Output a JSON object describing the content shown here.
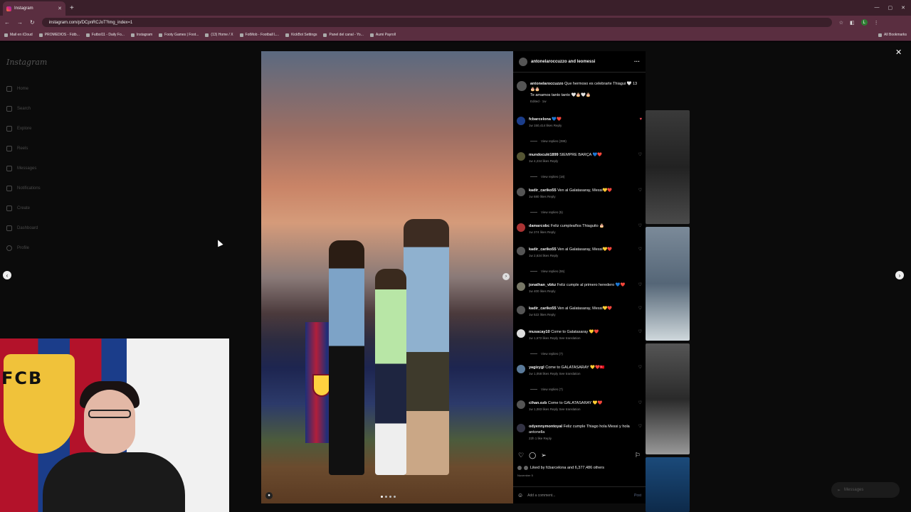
{
  "browser": {
    "tab_title": "Instagram",
    "tab_close": "✕",
    "new_tab": "+",
    "url": "instagram.com/p/DCpnRCJoT?img_index=1",
    "bookmarks": [
      "Mail en iCloud",
      "PROMEDIOS - Fútb...",
      "Futbol11 - Daily Fo...",
      "Instagram",
      "Footy Games | Foot...",
      "(13) Home / X",
      "FotMob - Football L...",
      "KickBot Settings",
      "Panel del canal - Yo...",
      "Aumi Payroll"
    ],
    "all_bookmarks": "All Bookmarks",
    "profile_initial": "L"
  },
  "sidebar": {
    "logo": "Instagram",
    "items": [
      {
        "label": "Home"
      },
      {
        "label": "Search"
      },
      {
        "label": "Explore"
      },
      {
        "label": "Reels"
      },
      {
        "label": "Messages"
      },
      {
        "label": "Notifications"
      },
      {
        "label": "Create"
      },
      {
        "label": "Dashboard"
      },
      {
        "label": "Profile"
      }
    ]
  },
  "post": {
    "header_author": "antonelaroccuzzo and leomessi",
    "caption": {
      "user": "antonelaroccuzzo",
      "text": "Que hermoso es celebrarte Thiagui 🤍 13 🎂🎂",
      "text2": "Te amamos tanto tanto 🤍🎂🤍🎂",
      "meta": "Edited · 1w"
    },
    "comments": [
      {
        "user": "fcbarcelona",
        "text": "💙❤️",
        "meta": "1w   150,414 likes   Reply",
        "replies": "View replies (399)",
        "liked": true
      },
      {
        "user": "mundoculé1899",
        "text": "SIEMPRE BARÇA 💙❤️",
        "meta": "1w   4,234 likes   Reply",
        "replies": "View replies (18)",
        "liked": false
      },
      {
        "user": "kadir_cariko55",
        "text": "Ven al Galatasaray, Messi💛❤️",
        "meta": "1w   680 likes   Reply",
        "replies": "View replies (5)",
        "liked": false
      },
      {
        "user": "damarcobc",
        "text": "Feliz cumpleaños Thiaguito 🎂",
        "meta": "1w   274 likes   Reply",
        "replies": "",
        "liked": false
      },
      {
        "user": "kadir_cariko55",
        "text": "Ven al Galatasaray, Messi💛❤️",
        "meta": "1w   2,634 likes   Reply",
        "replies": "View replies (55)",
        "liked": false
      },
      {
        "user": "jonathan_vbkz",
        "text": "Feliz cumple al primero heredero 💙❤️",
        "meta": "1w   400 likes   Reply",
        "replies": "",
        "liked": false
      },
      {
        "user": "kadir_cariko55",
        "text": "Ven al Galatasaray, Messi💛❤️",
        "meta": "1w   522 likes   Reply",
        "replies": "",
        "liked": false
      },
      {
        "user": "musacay10",
        "text": "Come to Galatasaray 💛❤️",
        "meta": "1w   1,672 likes   Reply   See translation",
        "replies": "View replies (7)",
        "liked": false
      },
      {
        "user": "yagizygl",
        "text": "Come to GALATASARAY 💛❤️🇹🇷",
        "meta": "1w   1,058 likes   Reply   See translation",
        "replies": "View replies (7)",
        "liked": false
      },
      {
        "user": "cihan.ozb",
        "text": "Come to GALATASARAY 💛❤️",
        "meta": "1w   1,083 likes   Reply   See translation",
        "replies": "",
        "liked": false
      },
      {
        "user": "odyennymontoyal",
        "text": "Feliz cumple Thiago hola Messi y hola antonella",
        "meta": "22h   1 like   Reply",
        "replies": "",
        "liked": false
      }
    ],
    "liked_by": "Liked by fcbarcelona and 6,377,486 others",
    "date": "November 5",
    "add_comment_placeholder": "Add a comment...",
    "post_button": "Post"
  },
  "messages_pill": "Messages",
  "close_label": "✕"
}
